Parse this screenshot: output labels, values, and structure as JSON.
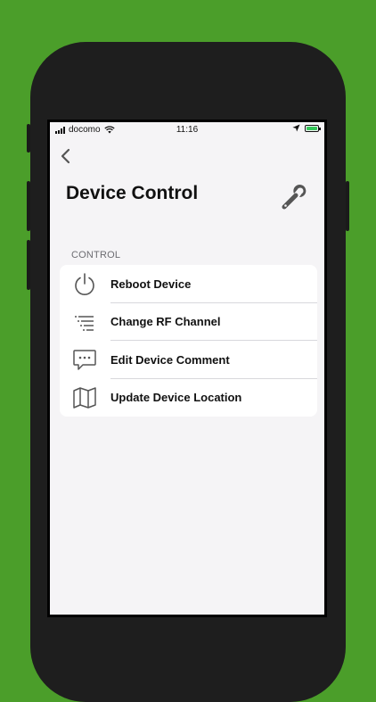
{
  "status_bar": {
    "carrier": "docomo",
    "time": "11:16"
  },
  "nav": {
    "back_icon": "chevron-left-icon"
  },
  "page": {
    "title": "Device Control",
    "header_icon": "wrench-icon"
  },
  "section": {
    "header": "CONTROL"
  },
  "items": [
    {
      "label": "Reboot Device",
      "icon": "power-icon"
    },
    {
      "label": "Change RF Channel",
      "icon": "list-icon"
    },
    {
      "label": "Edit Device Comment",
      "icon": "comment-icon"
    },
    {
      "label": "Update Device Location",
      "icon": "map-icon"
    }
  ],
  "colors": {
    "background": "#4b9e2a",
    "phone": "#1e1e1e",
    "screen_bg": "#f5f4f6",
    "battery": "#34c759"
  }
}
